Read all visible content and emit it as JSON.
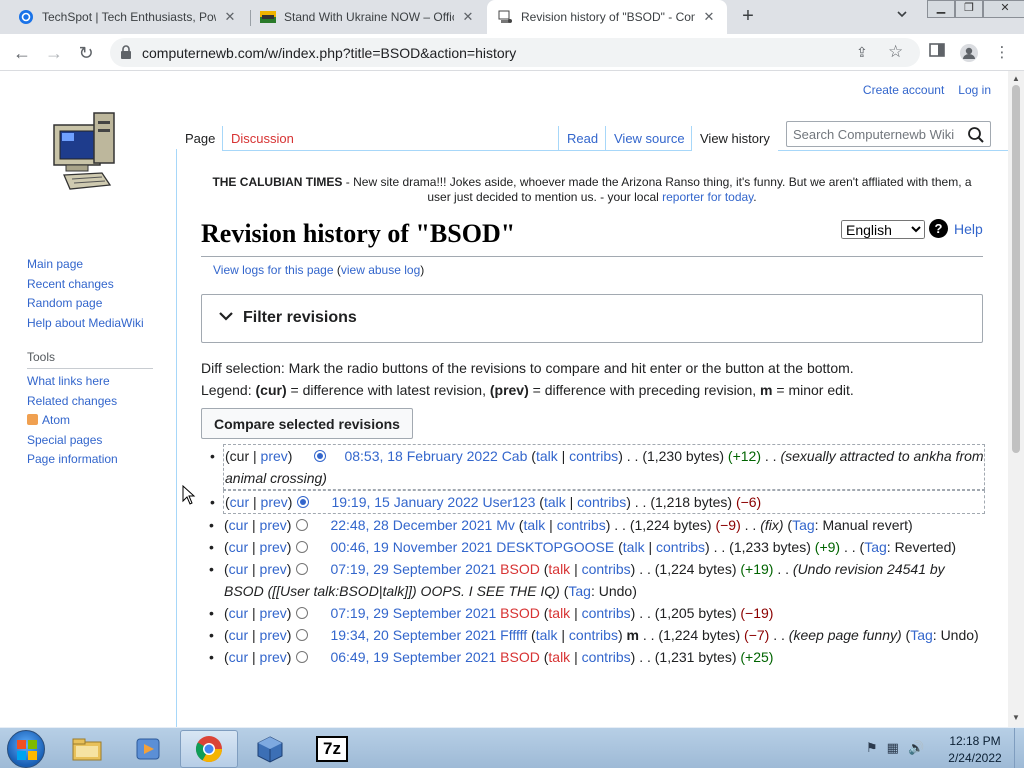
{
  "browser": {
    "tabs": [
      {
        "title": "TechSpot | Tech Enthusiasts, Pow",
        "icon": "techspot-icon"
      },
      {
        "title": "Stand With Ukraine NOW – Offic",
        "icon": "ukraine-flag-icon"
      },
      {
        "title": "Revision history of \"BSOD\" - Com",
        "icon": "computer-icon"
      }
    ],
    "new_tab": "+",
    "url": "computernewb.com/w/index.php?title=BSOD&action=history"
  },
  "wiki": {
    "user_nav": {
      "create_account": "Create account",
      "log_in": "Log in"
    },
    "page_tabs": {
      "page": "Page",
      "discussion": "Discussion",
      "read": "Read",
      "view_source": "View source",
      "view_history": "View history"
    },
    "search": {
      "placeholder": "Search Computernewb Wiki"
    },
    "navigation": [
      "Main page",
      "Recent changes",
      "Random page",
      "Help about MediaWiki"
    ],
    "tools_heading": "Tools",
    "tools": [
      "What links here",
      "Related changes",
      "Atom",
      "Special pages",
      "Page information"
    ],
    "site_notice": {
      "bold": "THE CALUBIAN TIMES",
      "text": " - New site drama!!! Jokes aside, whoever made the Arizona Ranso thing, it's funny. But we aren't affliated with them, a user just decided to mention us. - your local ",
      "link": "reporter for today",
      "end": "."
    },
    "language": "English",
    "help": "Help",
    "title": "Revision history of \"BSOD\"",
    "logs_link": "View logs for this page",
    "abuse_log": "view abuse log",
    "filter_label": "Filter revisions",
    "legend": {
      "line1": "Diff selection: Mark the radio buttons of the revisions to compare and hit enter or the button at the bottom.",
      "cur": "(cur)",
      "cur_desc": " = difference with latest revision, ",
      "prev": "(prev)",
      "prev_desc": " = difference with preceding revision, ",
      "m": "m",
      "m_desc": " = minor edit."
    },
    "legend_prefix": "Legend: ",
    "compare_button": "Compare selected revisions",
    "revisions": [
      {
        "date": "08:53, 18 February 2022",
        "user": "Cab",
        "user_red": false,
        "bytes": "(1,230 bytes)",
        "diff": "(+12)",
        "diff_sign": "pos",
        "minor": false,
        "comment": "(sexually attracted to ankha from animal crossing)",
        "tag": ""
      },
      {
        "date": "19:19, 15 January 2022",
        "user": "User123",
        "user_red": false,
        "bytes": "(1,218 bytes)",
        "diff": "(−6)",
        "diff_sign": "neg",
        "minor": false,
        "comment": "",
        "tag": ""
      },
      {
        "date": "22:48, 28 December 2021",
        "user": "Mv",
        "user_red": false,
        "bytes": "(1,224 bytes)",
        "diff": "(−9)",
        "diff_sign": "neg",
        "minor": false,
        "comment": "(fix)",
        "tag": "Manual revert"
      },
      {
        "date": "00:46, 19 November 2021",
        "user": "DESKTOPGOOSE",
        "user_red": false,
        "bytes": "(1,233 bytes)",
        "diff": "(+9)",
        "diff_sign": "pos",
        "minor": false,
        "comment": "",
        "tag": "Reverted"
      },
      {
        "date": "07:19, 29 September 2021",
        "user": "BSOD",
        "user_red": true,
        "bytes": "(1,224 bytes)",
        "diff": "(+19)",
        "diff_sign": "pos",
        "minor": false,
        "comment": "(Undo revision 24541 by BSOD ([[User talk:BSOD|talk]]) OOPS. I SEE THE IQ)",
        "tag": "Undo"
      },
      {
        "date": "07:19, 29 September 2021",
        "user": "BSOD",
        "user_red": true,
        "bytes": "(1,205 bytes)",
        "diff": "(−19)",
        "diff_sign": "neg",
        "minor": false,
        "comment": "",
        "tag": ""
      },
      {
        "date": "19:34, 20 September 2021",
        "user": "Ffffff",
        "user_red": false,
        "bytes": "(1,224 bytes)",
        "diff": "(−7)",
        "diff_sign": "neg",
        "minor": true,
        "comment": "(keep page funny)",
        "tag": "Undo"
      },
      {
        "date": "06:49, 19 September 2021",
        "user": "BSOD",
        "user_red": true,
        "bytes": "(1,231 bytes)",
        "diff": "(+25)",
        "diff_sign": "pos",
        "minor": false,
        "comment": "",
        "tag": ""
      }
    ],
    "labels": {
      "cur": "cur",
      "prev": "prev",
      "talk": "talk",
      "contribs": "contribs",
      "tag": "Tag",
      "minor": "m",
      "dots": ". ."
    }
  },
  "taskbar": {
    "apps": [
      "file-explorer-icon",
      "media-player-icon",
      "chrome-icon",
      "virtualbox-icon",
      "7zip-icon"
    ],
    "seven_zip": "7z",
    "time": "12:18 PM",
    "date": "2/24/2022"
  },
  "colors": {
    "link": "#3366cc",
    "redlink": "#d73333",
    "positive": "#006400",
    "negative": "#8b0000"
  }
}
